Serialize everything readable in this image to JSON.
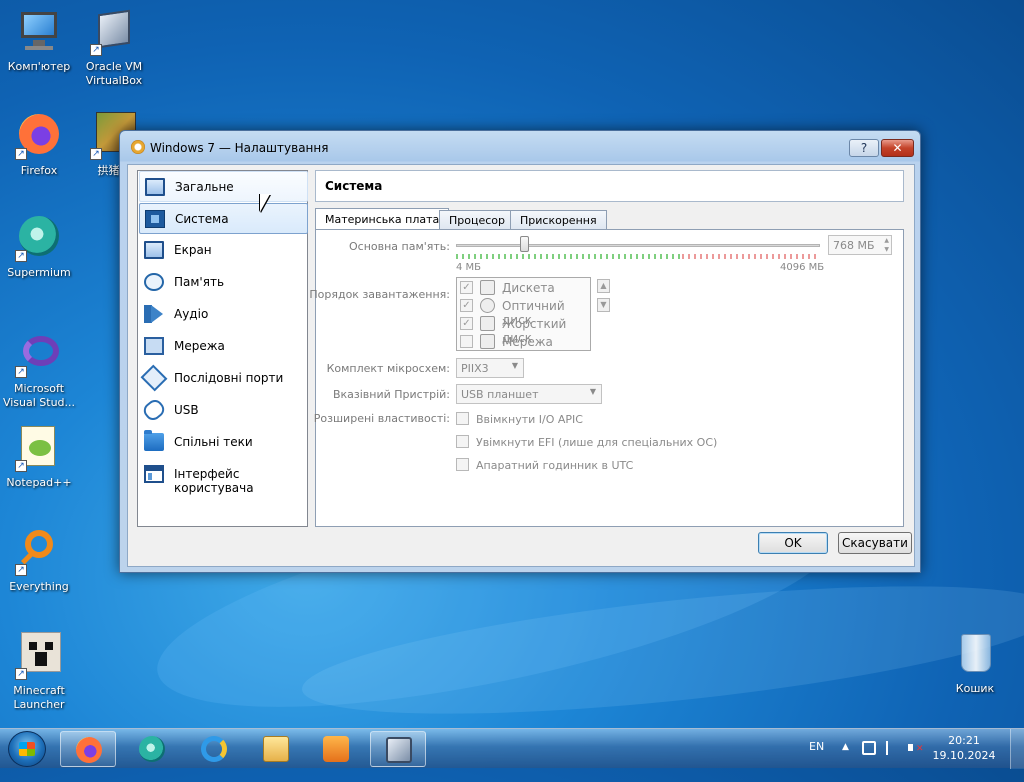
{
  "desktop": {
    "icons": [
      {
        "label": "Комп'ютер",
        "icon": "computer-icon"
      },
      {
        "label": "Oracle VM VirtualBox",
        "icon": "virtualbox-icon"
      },
      {
        "label": "Firefox",
        "icon": "firefox-icon"
      },
      {
        "label": "拱猪鋭",
        "icon": "game-icon"
      },
      {
        "label": "Supermium",
        "icon": "supermium-icon"
      },
      {
        "label": "Microsoft Visual Stud...",
        "icon": "visual-studio-icon"
      },
      {
        "label": "Notepad++",
        "icon": "notepadpp-icon"
      },
      {
        "label": "Everything",
        "icon": "everything-icon"
      },
      {
        "label": "Minecraft Launcher",
        "icon": "minecraft-icon"
      },
      {
        "label": "Кошик",
        "icon": "recycle-bin-icon"
      }
    ]
  },
  "window": {
    "title": "Windows 7 — Налаштування",
    "help_label": "?",
    "close_label": "✕",
    "sidebar": {
      "items": [
        {
          "label": "Загальне",
          "icon": "general-icon"
        },
        {
          "label": "Система",
          "icon": "system-icon"
        },
        {
          "label": "Екран",
          "icon": "display-icon"
        },
        {
          "label": "Пам'ять",
          "icon": "storage-icon"
        },
        {
          "label": "Аудіо",
          "icon": "audio-icon"
        },
        {
          "label": "Мережа",
          "icon": "network-icon"
        },
        {
          "label": "Послідовні порти",
          "icon": "serial-ports-icon"
        },
        {
          "label": "USB",
          "icon": "usb-icon"
        },
        {
          "label": "Спільні теки",
          "icon": "shared-folders-icon"
        },
        {
          "label": "Інтерфейс користувача",
          "icon": "user-interface-icon"
        }
      ],
      "selected": "Система"
    },
    "page_title": "Система",
    "tabs": [
      {
        "label": "Материнська плата",
        "active": true
      },
      {
        "label": "Процесор",
        "active": false
      },
      {
        "label": "Прискорення",
        "active": false
      }
    ],
    "motherboard": {
      "memory_label": "Основна пам'ять:",
      "memory_min": "4 МБ",
      "memory_max": "4096 МБ",
      "memory_value": "768 МБ",
      "memory_fraction": 0.187,
      "boot_order_label": "Порядок завантаження:",
      "boot_items": [
        {
          "label": "Дискета",
          "checked": true,
          "icon": "floppy-icon"
        },
        {
          "label": "Оптичний диск",
          "checked": true,
          "icon": "optical-disc-icon"
        },
        {
          "label": "Жорсткий диск",
          "checked": true,
          "icon": "hard-disk-icon"
        },
        {
          "label": "Мережа",
          "checked": false,
          "icon": "network-boot-icon"
        }
      ],
      "chipset_label": "Комплект мікросхем:",
      "chipset_value": "PIIX3",
      "pointing_label": "Вказівний Пристрій:",
      "pointing_value": "USB планшет",
      "extended_label": "Розширені властивості:",
      "extended_options": [
        {
          "label": "Ввімкнути I/O APIC",
          "checked": false
        },
        {
          "label": "Увімкнути EFI (лише для спеціальних ОС)",
          "checked": false
        },
        {
          "label": "Апаратний годинник в UTC",
          "checked": false
        }
      ]
    },
    "ok_label": "OK",
    "cancel_label": "Скасувати"
  },
  "taskbar": {
    "language": "EN",
    "time": "20:21",
    "date": "19.10.2024",
    "pinned": [
      "firefox-icon",
      "supermium-icon",
      "ie-icon",
      "explorer-icon",
      "media-player-icon",
      "virtualbox-icon"
    ]
  },
  "colors": {
    "accent": "#1d86d6",
    "selection": "#d9eafb",
    "close_button": "#c4432a"
  }
}
